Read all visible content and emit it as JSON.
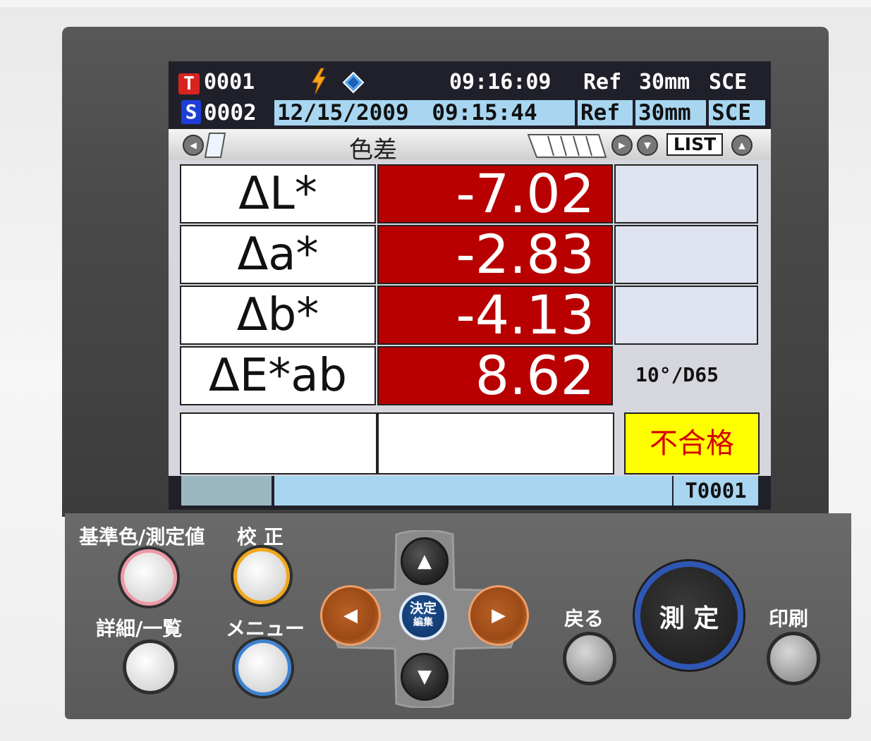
{
  "status_bar": {
    "target_badge": "T",
    "target_number": "0001",
    "time": "09:16:09",
    "mode": "Ref",
    "aperture": "30mm",
    "specular": "SCE"
  },
  "sample_bar": {
    "sample_badge": "S",
    "sample_number": "0002",
    "date": "12/15/2009",
    "time": "09:15:44",
    "mode": "Ref",
    "aperture": "30mm",
    "specular": "SCE"
  },
  "tab_bar": {
    "title": "色差",
    "list_label": "LIST"
  },
  "measurements": [
    {
      "label": "ΔL*",
      "value": "-7.02"
    },
    {
      "label": "Δa*",
      "value": "-2.83"
    },
    {
      "label": "Δb*",
      "value": "-4.13"
    },
    {
      "label": "ΔE*ab",
      "value": "8.62"
    }
  ],
  "observer": "10°/D65",
  "judgement": "不合格",
  "footer": {
    "target_id": "T0001"
  },
  "buttons": {
    "reference_measurement": "基準色/測定値",
    "calibration": "校 正",
    "detail_list": "詳細/一覧",
    "menu": "メニュー",
    "confirm_top": "決定",
    "confirm_bottom": "編集",
    "back": "戻る",
    "measure": "測 定",
    "print": "印刷"
  },
  "colors": {
    "value_bg": "#b80000",
    "judgement_bg": "#ffff00",
    "judgement_text": "#d40000",
    "header_cell_bg": "#a8d6f0"
  }
}
